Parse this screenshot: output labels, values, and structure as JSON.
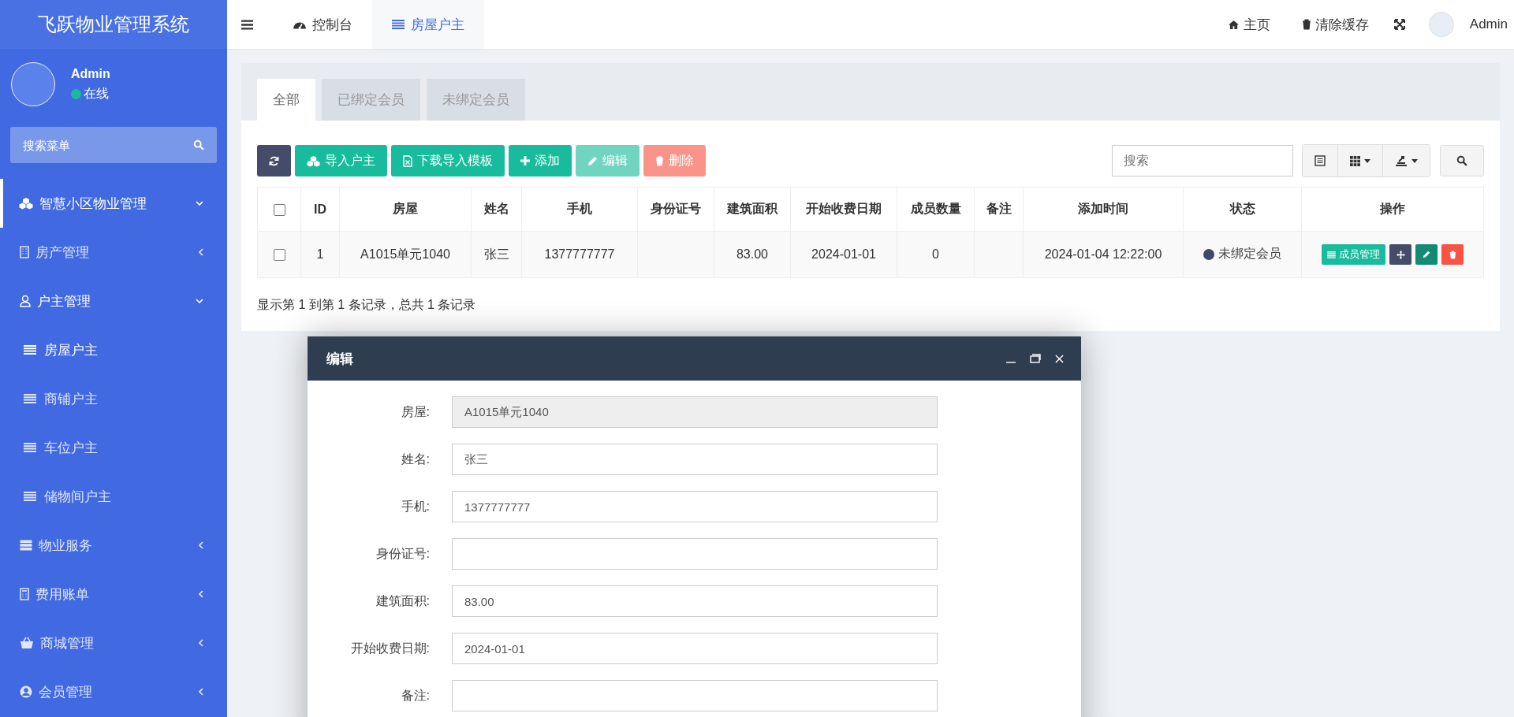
{
  "sidebar": {
    "title": "飞跃物业管理系统",
    "user": {
      "name": "Admin",
      "status": "在线"
    },
    "search": {
      "placeholder": "搜索菜单"
    },
    "menu": [
      {
        "label": "智慧小区物业管理",
        "expanded": true,
        "children": [
          {
            "label": "房产管理",
            "expanded": false
          },
          {
            "label": "户主管理",
            "expanded": true,
            "children": [
              {
                "label": "房屋户主",
                "selected": true
              },
              {
                "label": "商铺户主",
                "selected": false
              },
              {
                "label": "车位户主",
                "selected": false
              },
              {
                "label": "储物间户主",
                "selected": false
              }
            ]
          },
          {
            "label": "物业服务",
            "expanded": false
          },
          {
            "label": "费用账单",
            "expanded": false
          },
          {
            "label": "商城管理",
            "expanded": false
          },
          {
            "label": "会员管理",
            "expanded": false
          }
        ]
      }
    ]
  },
  "top_bar": {
    "tabs": [
      {
        "label": "控制台",
        "selected": false
      },
      {
        "label": "房屋户主",
        "selected": true
      }
    ],
    "links": [
      {
        "label": "主页"
      },
      {
        "label": "清除缓存"
      }
    ],
    "user": "Admin"
  },
  "content_tabs": [
    {
      "label": "全部",
      "selected": true
    },
    {
      "label": "已绑定会员",
      "selected": false
    },
    {
      "label": "未绑定会员",
      "selected": false
    }
  ],
  "toolbar": {
    "buttons": [
      {
        "kind": "refresh",
        "disabled": false
      },
      {
        "kind": "import",
        "label": "导入户主",
        "disabled": false
      },
      {
        "kind": "template",
        "label": "下载导入模板",
        "disabled": false
      },
      {
        "kind": "add",
        "label": "添加",
        "disabled": false
      },
      {
        "kind": "edit",
        "label": "编辑",
        "disabled": true
      },
      {
        "kind": "delete",
        "label": "删除",
        "disabled": true
      }
    ],
    "search": {
      "placeholder": "搜索"
    }
  },
  "table": {
    "select_all_checked": false,
    "columns": [
      "ID",
      "房屋",
      "姓名",
      "手机",
      "身份证号",
      "建筑面积",
      "开始收费日期",
      "成员数量",
      "备注",
      "添加时间",
      "状态",
      "操作"
    ],
    "rows": [
      {
        "checked": false,
        "cells": [
          "1",
          "A1015单元1040",
          "张三",
          "1377777777",
          null,
          "83.00",
          "2024-01-01",
          "0",
          null,
          "2024-01-04 12:22:00"
        ],
        "status": {
          "label": "未绑定会员",
          "color": "#3f4a6b"
        },
        "action": "成员管理"
      }
    ],
    "footer": "显示第 1 到第 1 条记录，总共 1 条记录"
  },
  "dialog": {
    "title": "编辑",
    "fields": [
      {
        "label": "房屋:",
        "value": "A1015单元1040",
        "disabled": true
      },
      {
        "label": "姓名:",
        "value": "张三",
        "disabled": false
      },
      {
        "label": "手机:",
        "value": "1377777777",
        "disabled": false
      },
      {
        "label": "身份证号:",
        "disabled": false
      },
      {
        "label": "建筑面积:",
        "value": "83.00",
        "disabled": false
      },
      {
        "label": "开始收费日期:",
        "value": "2024-01-01",
        "disabled": false
      },
      {
        "label": "备注:",
        "disabled": false
      }
    ]
  }
}
